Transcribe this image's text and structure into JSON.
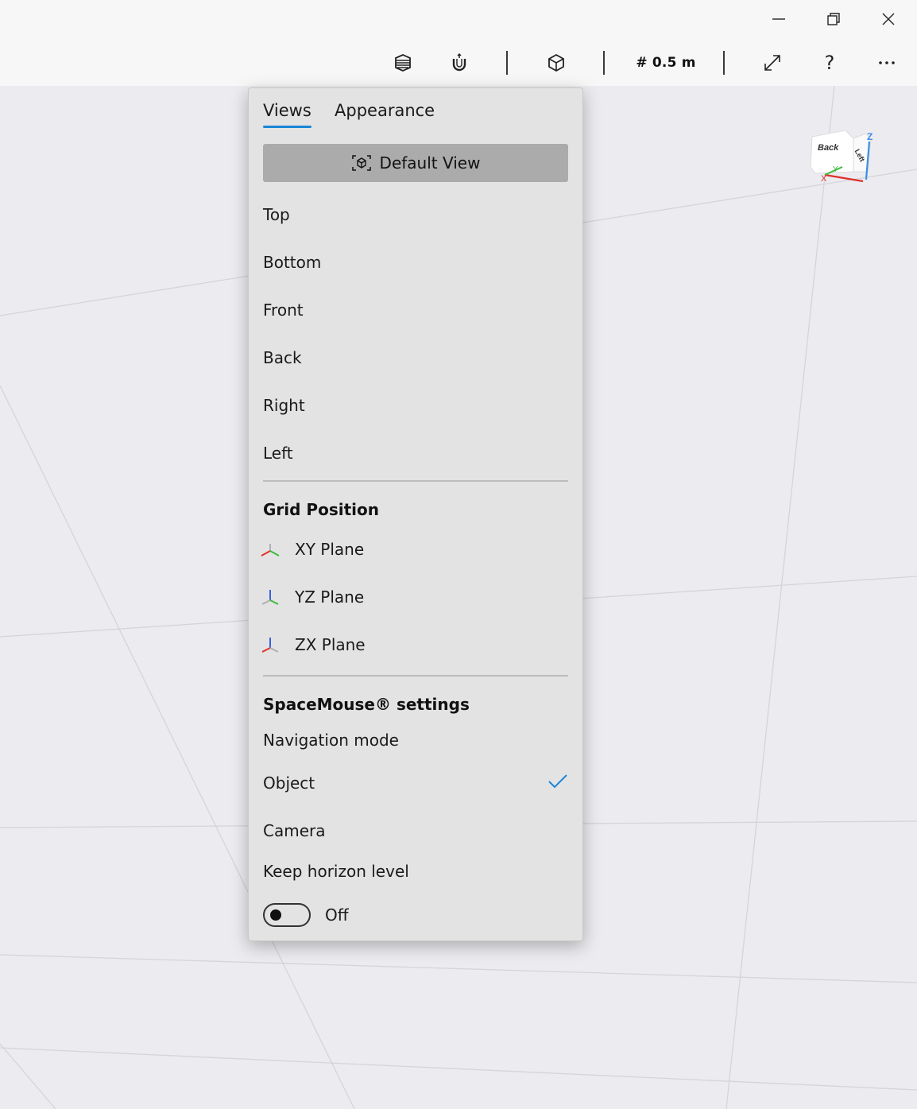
{
  "window_controls": {
    "minimize_icon": "minimize-icon",
    "restore_icon": "restore-icon",
    "close_icon": "close-icon"
  },
  "toolbar": {
    "grid_size": "# 0.5 m",
    "icons": [
      "material-icon",
      "magnet-snap-icon",
      "scene-object-icon",
      "fullscreen-icon",
      "help-icon",
      "more-icon"
    ],
    "help_label": "?"
  },
  "nav_cube": {
    "faces": [
      "Back",
      "Left"
    ],
    "axis_labels": {
      "z": "Z",
      "y": "Y",
      "x": "X"
    },
    "colors": {
      "x": "#e0302a",
      "y": "#3dbb3d",
      "z": "#3a8ee6"
    }
  },
  "flyout": {
    "tabs": [
      {
        "label": "Views",
        "active": true
      },
      {
        "label": "Appearance",
        "active": false
      }
    ],
    "default_view_label": "Default View",
    "views": [
      "Top",
      "Bottom",
      "Front",
      "Back",
      "Right",
      "Left"
    ],
    "grid_position": {
      "heading": "Grid Position",
      "planes": [
        "XY Plane",
        "YZ Plane",
        "ZX Plane"
      ]
    },
    "spacemouse": {
      "heading": "SpaceMouse® settings",
      "navigation_mode_label": "Navigation mode",
      "modes": [
        {
          "label": "Object",
          "selected": true
        },
        {
          "label": "Camera",
          "selected": false
        }
      ],
      "horizon_label": "Keep horizon level",
      "toggle_state": "Off"
    },
    "accent_color": "#1a86d6"
  }
}
